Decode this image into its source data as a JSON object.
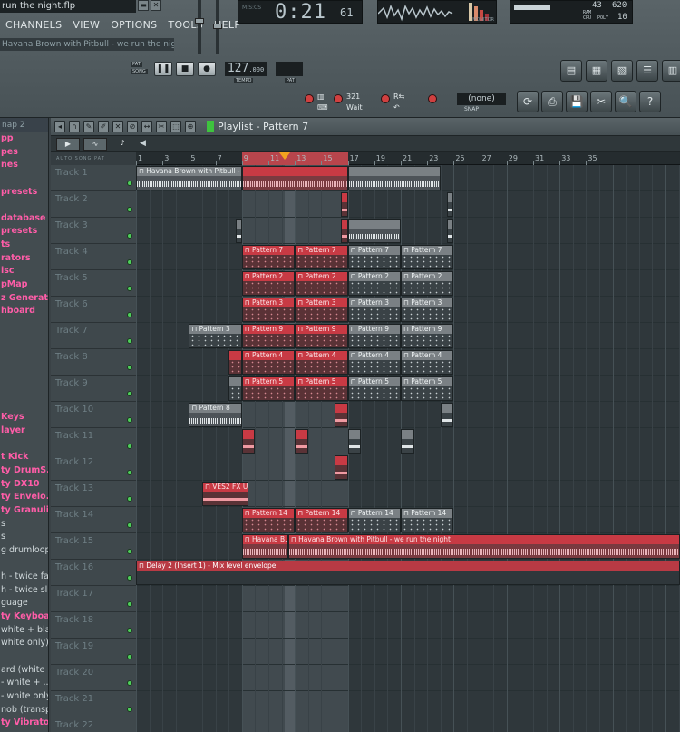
{
  "window": {
    "title": "run the night.flp",
    "hint": "Havana Brown with Pitbull - we run the night"
  },
  "menus": [
    "CHANNELS",
    "VIEW",
    "OPTIONS",
    "TOOLS",
    "HELP"
  ],
  "time_display": {
    "main": "0:21",
    "sub": "61"
  },
  "cpu_display": {
    "value1": "43",
    "value2": "620",
    "value3": "10",
    "ram_label": "RAM",
    "cpu_label": "CPU",
    "poly_label": "POLY"
  },
  "scope_label": "MONITOR",
  "transport": {
    "pat_label": "PAT",
    "song_label": "SONG",
    "tempo": "127",
    "tempo_sub": ".000",
    "tempo_label": "TEMPO",
    "pat_display_label": "PAT"
  },
  "snap": {
    "value": "(none)",
    "label": "SNAP"
  },
  "browser": {
    "tab": "nap 2",
    "items": [
      {
        "label": "pp",
        "kind": "folder"
      },
      {
        "label": "pes",
        "kind": "folder"
      },
      {
        "label": "nes",
        "kind": "folder"
      },
      {
        "label": "",
        "kind": "empty"
      },
      {
        "label": "presets",
        "kind": "folder"
      },
      {
        "label": "",
        "kind": "empty"
      },
      {
        "label": "database",
        "kind": "folder"
      },
      {
        "label": "presets",
        "kind": "folder"
      },
      {
        "label": "ts",
        "kind": "folder"
      },
      {
        "label": "rators",
        "kind": "folder"
      },
      {
        "label": "isc",
        "kind": "folder"
      },
      {
        "label": "pMap",
        "kind": "folder"
      },
      {
        "label": "z Generat...",
        "kind": "folder"
      },
      {
        "label": "hboard",
        "kind": "folder"
      },
      {
        "label": "",
        "kind": "empty"
      },
      {
        "label": "",
        "kind": "empty"
      },
      {
        "label": "",
        "kind": "empty"
      },
      {
        "label": "",
        "kind": "empty"
      },
      {
        "label": "",
        "kind": "empty"
      },
      {
        "label": "",
        "kind": "empty"
      },
      {
        "label": "",
        "kind": "empty"
      },
      {
        "label": "Keys",
        "kind": "folder"
      },
      {
        "label": "layer",
        "kind": "folder"
      },
      {
        "label": "",
        "kind": "empty"
      },
      {
        "label": "t Kick",
        "kind": "folder"
      },
      {
        "label": "ty DrumS...",
        "kind": "folder"
      },
      {
        "label": "ty DX10",
        "kind": "folder"
      },
      {
        "label": "ty Envelo...",
        "kind": "folder"
      },
      {
        "label": "ty Granuli...",
        "kind": "folder"
      },
      {
        "label": "s",
        "kind": "file"
      },
      {
        "label": "s",
        "kind": "file"
      },
      {
        "label": "g drumloops",
        "kind": "file"
      },
      {
        "label": "",
        "kind": "empty"
      },
      {
        "label": "h - twice fa...",
        "kind": "file"
      },
      {
        "label": "h - twice sl...",
        "kind": "file"
      },
      {
        "label": "guage",
        "kind": "file"
      },
      {
        "label": "ty Keyboa...",
        "kind": "folder"
      },
      {
        "label": "white + bla...",
        "kind": "file"
      },
      {
        "label": "white only)",
        "kind": "file"
      },
      {
        "label": "",
        "kind": "empty"
      },
      {
        "label": "ard (white ...",
        "kind": "file"
      },
      {
        "label": "- white + ...",
        "kind": "file"
      },
      {
        "label": "- white only",
        "kind": "file"
      },
      {
        "label": "nob (transp...",
        "kind": "file"
      },
      {
        "label": "ty Vibrator",
        "kind": "folder"
      },
      {
        "label": "ty Wrapp...",
        "kind": "folder"
      },
      {
        "label": "ty Wrapp...",
        "kind": "folder"
      }
    ]
  },
  "playlist": {
    "title": "Playlist - Pattern 7",
    "mode_labels": "AUTO  SONG  PAT",
    "ruler_ticks": [
      "1",
      "3",
      "5",
      "7",
      "9",
      "11",
      "13",
      "15",
      "17",
      "19",
      "21",
      "23",
      "25",
      "27",
      "29",
      "31",
      "33",
      "35"
    ],
    "tracks": [
      "Track 1",
      "Track 2",
      "Track 3",
      "Track 4",
      "Track 5",
      "Track 6",
      "Track 7",
      "Track 8",
      "Track 9",
      "Track 10",
      "Track 11",
      "Track 12",
      "Track 13",
      "Track 14",
      "Track 15",
      "Track 16",
      "Track 17",
      "Track 18",
      "Track 19",
      "Track 20",
      "Track 21",
      "Track 22"
    ],
    "clips": [
      {
        "track": 0,
        "start": 1,
        "len": 8,
        "label": "Havana Brown with Pitbull - ...",
        "style": "audio grey"
      },
      {
        "track": 0,
        "start": 9,
        "len": 8,
        "label": "",
        "style": "audio red"
      },
      {
        "track": 0,
        "start": 17,
        "len": 7,
        "label": "",
        "style": "audio grey"
      },
      {
        "track": 1,
        "start": 16.5,
        "len": 0.5,
        "label": "",
        "style": "small red"
      },
      {
        "track": 1,
        "start": 24.5,
        "len": 0.5,
        "label": "",
        "style": "small grey"
      },
      {
        "track": 2,
        "start": 8.5,
        "len": 0.5,
        "label": "",
        "style": "small grey"
      },
      {
        "track": 2,
        "start": 16.5,
        "len": 0.5,
        "label": "",
        "style": "small red"
      },
      {
        "track": 2,
        "start": 17,
        "len": 4,
        "label": "",
        "style": "audio grey"
      },
      {
        "track": 2,
        "start": 24.5,
        "len": 0.5,
        "label": "",
        "style": "small grey"
      },
      {
        "track": 3,
        "start": 9,
        "len": 4,
        "label": "Pattern 7",
        "style": "red"
      },
      {
        "track": 3,
        "start": 13,
        "len": 4,
        "label": "Pattern 7",
        "style": "red"
      },
      {
        "track": 3,
        "start": 17,
        "len": 4,
        "label": "Pattern 7",
        "style": "grey"
      },
      {
        "track": 3,
        "start": 21,
        "len": 4,
        "label": "Pattern 7",
        "style": "grey"
      },
      {
        "track": 4,
        "start": 9,
        "len": 4,
        "label": "Pattern 2",
        "style": "red"
      },
      {
        "track": 4,
        "start": 13,
        "len": 4,
        "label": "Pattern 2",
        "style": "red"
      },
      {
        "track": 4,
        "start": 17,
        "len": 4,
        "label": "Pattern 2",
        "style": "grey"
      },
      {
        "track": 4,
        "start": 21,
        "len": 4,
        "label": "Pattern 2",
        "style": "grey"
      },
      {
        "track": 5,
        "start": 9,
        "len": 4,
        "label": "Pattern 3",
        "style": "red"
      },
      {
        "track": 5,
        "start": 13,
        "len": 4,
        "label": "Pattern 3",
        "style": "red"
      },
      {
        "track": 5,
        "start": 17,
        "len": 4,
        "label": "Pattern 3",
        "style": "grey"
      },
      {
        "track": 5,
        "start": 21,
        "len": 4,
        "label": "Pattern 3",
        "style": "grey"
      },
      {
        "track": 6,
        "start": 5,
        "len": 4,
        "label": "Pattern 3",
        "style": "grey"
      },
      {
        "track": 6,
        "start": 9,
        "len": 4,
        "label": "Pattern 9",
        "style": "red"
      },
      {
        "track": 6,
        "start": 13,
        "len": 4,
        "label": "Pattern 9",
        "style": "red"
      },
      {
        "track": 6,
        "start": 17,
        "len": 4,
        "label": "Pattern 9",
        "style": "grey"
      },
      {
        "track": 6,
        "start": 21,
        "len": 4,
        "label": "Pattern 9",
        "style": "grey"
      },
      {
        "track": 7,
        "start": 8,
        "len": 1,
        "label": "",
        "style": "red"
      },
      {
        "track": 7,
        "start": 9,
        "len": 4,
        "label": "Pattern 4",
        "style": "red"
      },
      {
        "track": 7,
        "start": 13,
        "len": 4,
        "label": "Pattern 4",
        "style": "red"
      },
      {
        "track": 7,
        "start": 17,
        "len": 4,
        "label": "Pattern 4",
        "style": "grey"
      },
      {
        "track": 7,
        "start": 21,
        "len": 4,
        "label": "Pattern 4",
        "style": "grey"
      },
      {
        "track": 8,
        "start": 8,
        "len": 1,
        "label": "",
        "style": "grey"
      },
      {
        "track": 8,
        "start": 9,
        "len": 4,
        "label": "Pattern 5",
        "style": "red"
      },
      {
        "track": 8,
        "start": 13,
        "len": 4,
        "label": "Pattern 5",
        "style": "red"
      },
      {
        "track": 8,
        "start": 17,
        "len": 4,
        "label": "Pattern 5",
        "style": "grey"
      },
      {
        "track": 8,
        "start": 21,
        "len": 4,
        "label": "Pattern 5",
        "style": "grey"
      },
      {
        "track": 9,
        "start": 5,
        "len": 4,
        "label": "Pattern 8",
        "style": "audio grey"
      },
      {
        "track": 9,
        "start": 16,
        "len": 1,
        "label": "",
        "style": "small red"
      },
      {
        "track": 9,
        "start": 24,
        "len": 1,
        "label": "",
        "style": "small grey"
      },
      {
        "track": 10,
        "start": 9,
        "len": 1,
        "label": "",
        "style": "small red"
      },
      {
        "track": 10,
        "start": 13,
        "len": 1,
        "label": "",
        "style": "small red"
      },
      {
        "track": 10,
        "start": 17,
        "len": 1,
        "label": "",
        "style": "small grey"
      },
      {
        "track": 10,
        "start": 21,
        "len": 1,
        "label": "",
        "style": "small grey"
      },
      {
        "track": 11,
        "start": 16,
        "len": 1,
        "label": "",
        "style": "small red"
      },
      {
        "track": 12,
        "start": 6,
        "len": 3.5,
        "label": "VES2 FX Up...",
        "style": "small red"
      },
      {
        "track": 13,
        "start": 9,
        "len": 4,
        "label": "Pattern 14",
        "style": "red"
      },
      {
        "track": 13,
        "start": 13,
        "len": 4,
        "label": "Pattern 14",
        "style": "red"
      },
      {
        "track": 13,
        "start": 17,
        "len": 4,
        "label": "Pattern 14",
        "style": "grey"
      },
      {
        "track": 13,
        "start": 21,
        "len": 4,
        "label": "Pattern 14",
        "style": "grey"
      },
      {
        "track": 14,
        "start": 9,
        "len": 3.5,
        "label": "Havana B...",
        "style": "audio red"
      },
      {
        "track": 14,
        "start": 12.5,
        "len": 30,
        "label": "Havana Brown with Pitbull - we run the night",
        "style": "audio red"
      },
      {
        "track": 15,
        "start": 1,
        "len": 42,
        "label": "Delay 2 (Insert 1) - Mix level envelope",
        "style": "auto"
      }
    ]
  },
  "colors": {
    "accent_red": "#c83a44",
    "led_green": "#4ecf5a",
    "browser_folder": "#ff5da8"
  }
}
